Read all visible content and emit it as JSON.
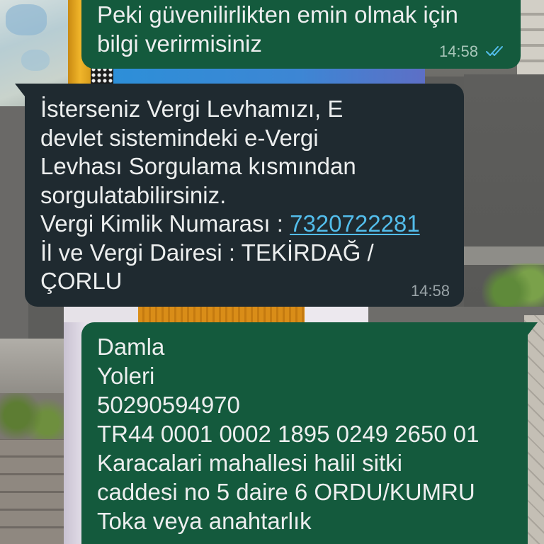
{
  "chat": {
    "messages": [
      {
        "direction": "outgoing",
        "lines": [
          "Peki güvenilirlikten emin olmak için",
          "bilgi verirmisiniz"
        ],
        "time": "14:58",
        "status_icon": "double-check-icon",
        "status": "read"
      },
      {
        "direction": "incoming",
        "lines": [
          "İsterseniz Vergi Levhamızı, E",
          "devlet sistemindeki e-Vergi",
          "Levhası Sorgulama kısmından",
          "sorgulatabilirsiniz."
        ],
        "tax_id_label": "Vergi Kimlik Numarası : ",
        "tax_id_link": "7320722281",
        "lines_after": [
          "İl ve Vergi Dairesi : TEKİRDAĞ /",
          "ÇORLU"
        ],
        "time": "14:58"
      },
      {
        "direction": "outgoing",
        "lines": [
          "Damla",
          "Yoleri",
          "50290594970",
          "TR44 0001 0002 1895 0249 2650 01",
          "Karacalari mahallesi halil sitki",
          "caddesi no 5 daire 6 ORDU/KUMRU",
          "Toka veya anahtarlık"
        ]
      }
    ]
  },
  "colors": {
    "outgoing_bubble": "#145a3d",
    "incoming_bubble": "#1f2a30",
    "text": "#eceeee",
    "link": "#53bdeb",
    "read_ticks": "#53bdeb"
  }
}
